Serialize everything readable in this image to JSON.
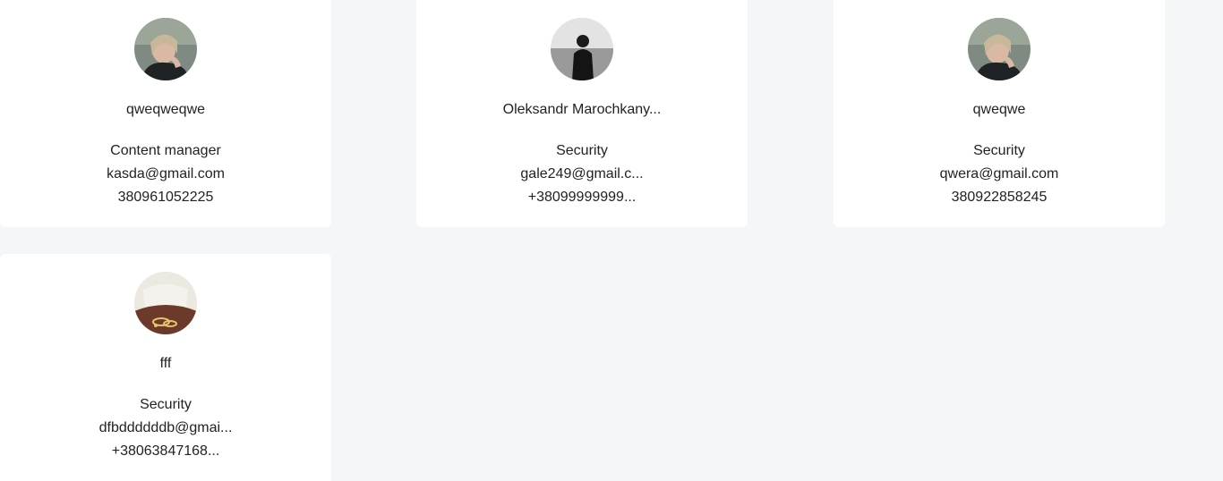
{
  "users": [
    {
      "name": "qweqweqwe",
      "role": "Content manager",
      "email": "kasda@gmail.com",
      "phone": "380961052225",
      "avatar_icon": "user-photo-woman-icon"
    },
    {
      "name": "Oleksandr Marochkany...",
      "role": "Security",
      "email": "gale249@gmail.c...",
      "phone": "+38099999999...",
      "avatar_icon": "user-photo-man-seaside-icon"
    },
    {
      "name": "qweqwe",
      "role": "Security",
      "email": "qwera@gmail.com",
      "phone": "380922858245",
      "avatar_icon": "user-photo-woman-icon"
    },
    {
      "name": "fff",
      "role": "Security",
      "email": "dfbddddddb@gmai...",
      "phone": "+38063847168...",
      "avatar_icon": "user-photo-food-icon"
    }
  ]
}
